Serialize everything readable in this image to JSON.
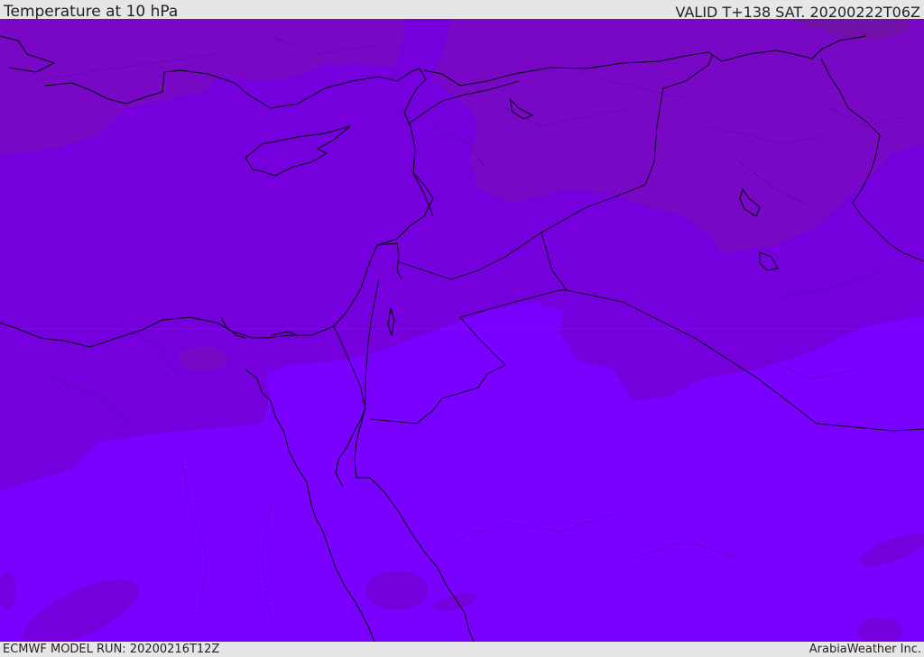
{
  "header": {
    "title": "Temperature at 10 hPa",
    "valid_time": "VALID T+138 SAT. 20200222T06Z"
  },
  "footer": {
    "model_run": "ECMWF MODEL RUN: 20200216T12Z",
    "credit": "ArabiaWeather Inc."
  },
  "map": {
    "colors": {
      "band_coldest": "#7010a8",
      "band_cold": "#7808c6",
      "band_mid": "#7500dd",
      "band_warm": "#7a00ff",
      "coastline": "#000000"
    }
  }
}
